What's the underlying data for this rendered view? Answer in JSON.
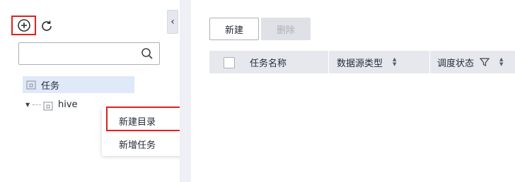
{
  "left_panel": {
    "add_icon": "plus-circle-icon",
    "refresh_icon": "refresh-icon",
    "collapse_icon": "chevron-left-icon",
    "search": {
      "placeholder": "",
      "value": "",
      "icon": "search-icon"
    },
    "tree": {
      "root": {
        "label": "任务",
        "icon": "folder-icon"
      },
      "child": {
        "label": "hive",
        "icon": "folder-icon",
        "expanded": true
      }
    },
    "context_menu": {
      "items": [
        {
          "label": "新建目录",
          "highlighted": true
        },
        {
          "label": "新增任务"
        }
      ]
    }
  },
  "toolbar": {
    "new_label": "新建",
    "delete_label": "删除",
    "delete_disabled": true
  },
  "table": {
    "columns": [
      {
        "label": "任务名称"
      },
      {
        "label": "数据源类型",
        "sortable": true
      },
      {
        "label": "调度状态",
        "filterable": true,
        "sortable": true
      }
    ],
    "rows": []
  },
  "colors": {
    "highlight_border": "#e02020",
    "selected_tree_bg": "#dfe9f7",
    "header_bg": "#e6e8ed"
  }
}
